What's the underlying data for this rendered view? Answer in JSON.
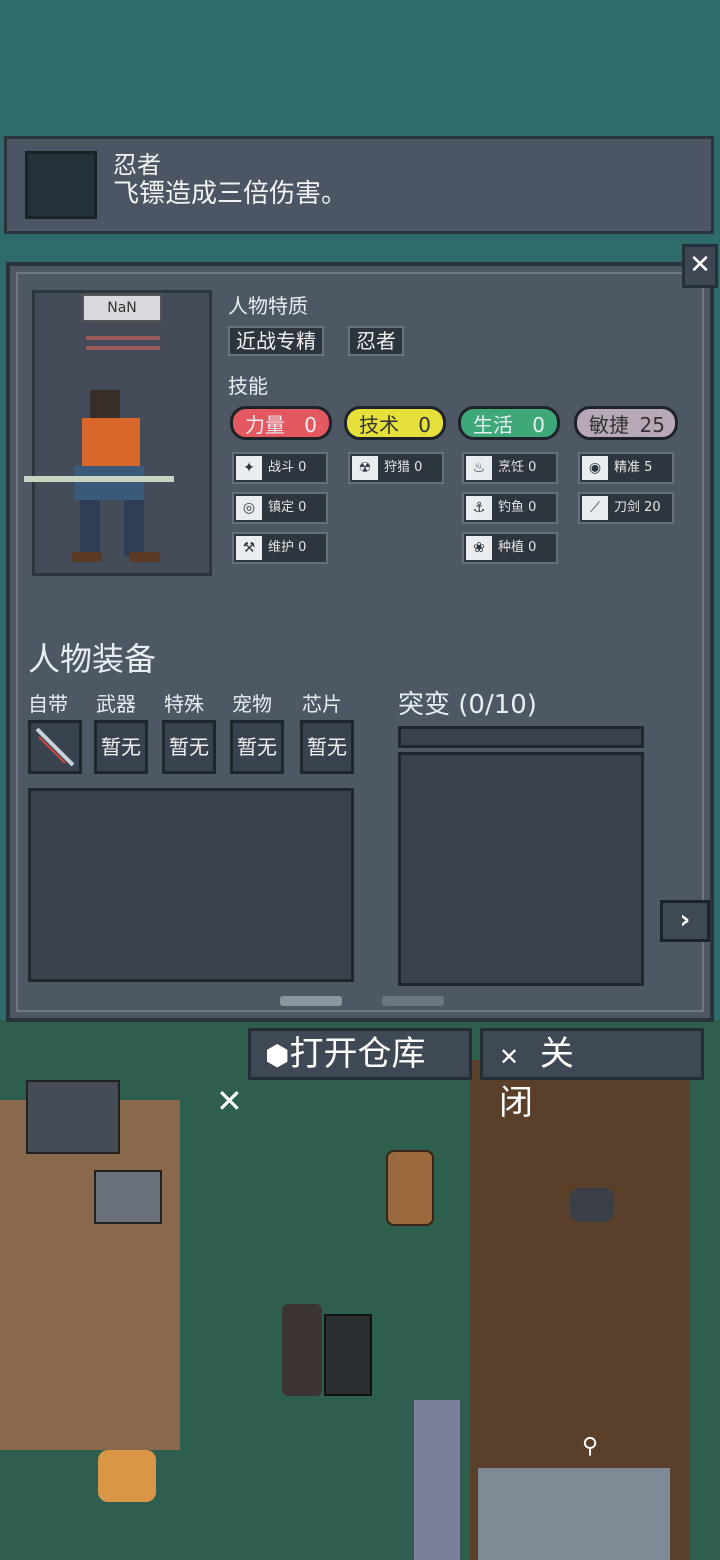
{
  "tooltip": {
    "name": "忍者",
    "description": "飞镖造成三倍伤害。"
  },
  "character": {
    "name_tag": "NaN"
  },
  "traits": {
    "title": "人物特质",
    "items": [
      "近战专精",
      "忍者"
    ]
  },
  "skills": {
    "title": "技能",
    "categories": [
      {
        "label": "力量",
        "value": "0",
        "color": "#e3595f"
      },
      {
        "label": "技术",
        "value": "0",
        "color": "#e5e03a"
      },
      {
        "label": "生活",
        "value": "0",
        "color": "#3fa879"
      },
      {
        "label": "敏捷",
        "value": "25",
        "color": "#b8a8b8"
      }
    ],
    "col1": [
      {
        "name": "战斗",
        "value": "0"
      },
      {
        "name": "镇定",
        "value": "0"
      },
      {
        "name": "维护",
        "value": "0"
      }
    ],
    "col2": [
      {
        "name": "狩猎",
        "value": "0"
      }
    ],
    "col3": [
      {
        "name": "烹饪",
        "value": "0"
      },
      {
        "name": "钓鱼",
        "value": "0"
      },
      {
        "name": "种植",
        "value": "0"
      }
    ],
    "col4": [
      {
        "name": "精准",
        "value": "5"
      },
      {
        "name": "刀剑",
        "value": "20"
      }
    ]
  },
  "equipment": {
    "title": "人物装备",
    "slots": [
      {
        "label": "自带",
        "value": ""
      },
      {
        "label": "武器",
        "value": "暂无"
      },
      {
        "label": "特殊",
        "value": "暂无"
      },
      {
        "label": "宠物",
        "value": "暂无"
      },
      {
        "label": "芯片",
        "value": "暂无"
      }
    ]
  },
  "mutation": {
    "title": "突变 (0/10)"
  },
  "buttons": {
    "open_storage": "打开仓库",
    "close": "关 闭"
  }
}
